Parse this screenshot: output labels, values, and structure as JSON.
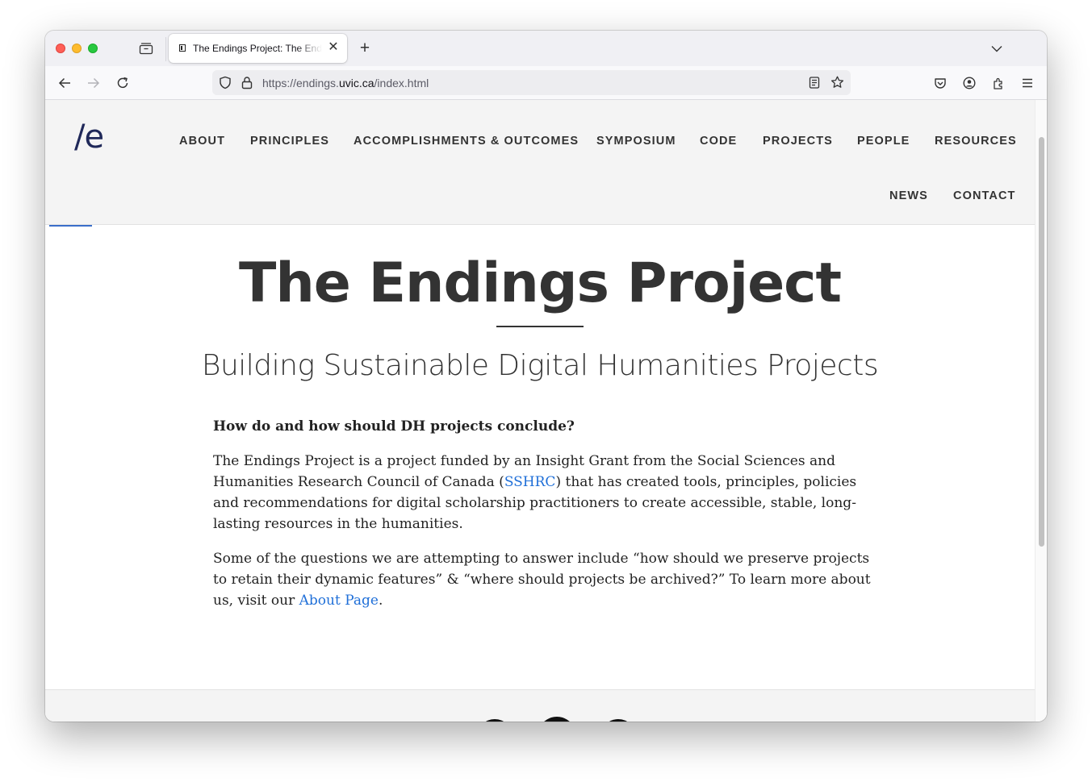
{
  "browser": {
    "tab_title": "The Endings Project: The Endings Project",
    "tab_close": "✕",
    "new_tab": "+",
    "url_prefix": "https://endings.",
    "url_host": "uvic.ca",
    "url_path": "/index.html"
  },
  "site": {
    "logo": "/e",
    "menu": {
      "about": "ABOUT",
      "principles": "PRINCIPLES",
      "accomplishments": "ACCOMPLISHMENTS & OUTCOMES",
      "symposium": "SYMPOSIUM",
      "code": "CODE",
      "projects": "PROJECTS",
      "people": "PEOPLE",
      "resources": "RESOURCES",
      "news": "NEWS",
      "contact": "CONTACT"
    },
    "title": "The Endings Project",
    "subtitle": "Building Sustainable Digital Humanities Projects",
    "question": "How do and how should DH projects conclude?",
    "p1_before": "The Endings Project is a project funded by an Insight Grant from the Social Sciences and Humanities Research Council of Canada (",
    "p1_link": "SSHRC",
    "p1_after": ") that has created tools, principles, policies and recommendations for digital scholarship practitioners to create accessible, stable, long-lasting resources in the humanities.",
    "p2_before": "Some of the questions we are attempting to answer include “how should we preserve projects to retain their dynamic features” & “where should projects be archived?” To learn more about us, visit our ",
    "p2_link": "About Page",
    "p2_after": "."
  },
  "colors": {
    "link": "#1f6fd8",
    "logo": "#1f2859",
    "text": "#333333"
  }
}
